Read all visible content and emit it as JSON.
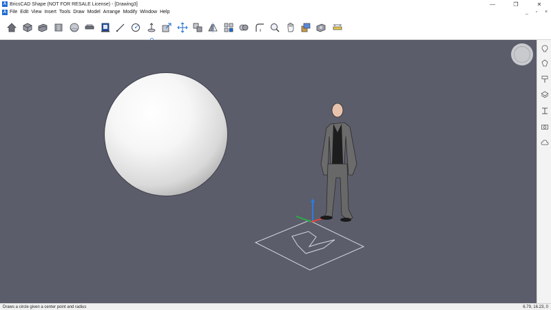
{
  "window": {
    "title": "BricsCAD Shape (NOT FOR RESALE License) - [Drawing3]",
    "app_icon": "A",
    "controls": [
      "—",
      "❐",
      "✕"
    ]
  },
  "menubar": {
    "logo": "A",
    "items": [
      "File",
      "Edit",
      "View",
      "Insert",
      "Tools",
      "Draw",
      "Model",
      "Arrange",
      "Modify",
      "Window",
      "Help"
    ],
    "mdi_controls": [
      "_",
      "▫",
      "×"
    ]
  },
  "toolbar": {
    "tools": [
      "home-icon",
      "box-icon",
      "stack-icon",
      "cylinder-icon",
      "sphere-icon",
      "slab-icon",
      "window-icon",
      "line-icon",
      "circle-icon",
      "extrude-icon",
      "push-pull-icon",
      "move-icon",
      "copy-icon",
      "mirror-icon",
      "array-icon",
      "union-icon",
      "fillet-icon",
      "zoom-icon",
      "pan-icon",
      "materials-icon",
      "render-icon",
      "level-icon"
    ]
  },
  "sidepanel": {
    "icons": [
      "lightbulb-icon",
      "materials-icon",
      "paint-icon",
      "layers-icon",
      "beam-icon",
      "camera-icon",
      "cloud-icon"
    ]
  },
  "statusbar": {
    "hint": "Draws a circle given a center point and radius",
    "coords": "6.79, 16.23, 0"
  },
  "colors": {
    "viewport": "#5b5d6b",
    "accent": "#1e6bd6"
  }
}
